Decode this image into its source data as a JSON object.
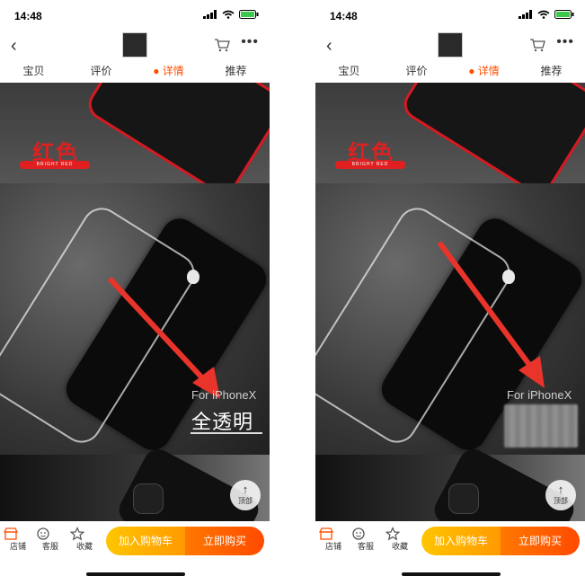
{
  "phones": [
    {
      "status": {
        "time": "14:48"
      },
      "tabs": [
        "宝贝",
        "评价",
        "详情",
        "推荐"
      ],
      "active_tab": 2,
      "banner": {
        "color_label": "红色",
        "color_sub": "BRIGHT RED",
        "for_label": "For iPhoneX",
        "big_label": "全透明"
      },
      "back_to_top": {
        "arrow": "↑",
        "label": "顶部"
      },
      "bottombar": {
        "shop": "店铺",
        "service": "客服",
        "favorite": "收藏",
        "add_cart": "加入购物车",
        "buy_now": "立即购买"
      }
    },
    {
      "status": {
        "time": "14:48"
      },
      "tabs": [
        "宝贝",
        "评价",
        "详情",
        "推荐"
      ],
      "active_tab": 2,
      "banner": {
        "color_label": "红色",
        "color_sub": "BRIGHT RED",
        "for_label": "For iPhoneX",
        "big_label": ""
      },
      "back_to_top": {
        "arrow": "↑",
        "label": "顶部"
      },
      "bottombar": {
        "shop": "店铺",
        "service": "客服",
        "favorite": "收藏",
        "add_cart": "加入购物车",
        "buy_now": "立即购买"
      }
    }
  ],
  "colors": {
    "accent": "#ff5000",
    "case_red": "#e02020",
    "cart_button": "#ffb000",
    "buy_button": "#ff5a00"
  }
}
